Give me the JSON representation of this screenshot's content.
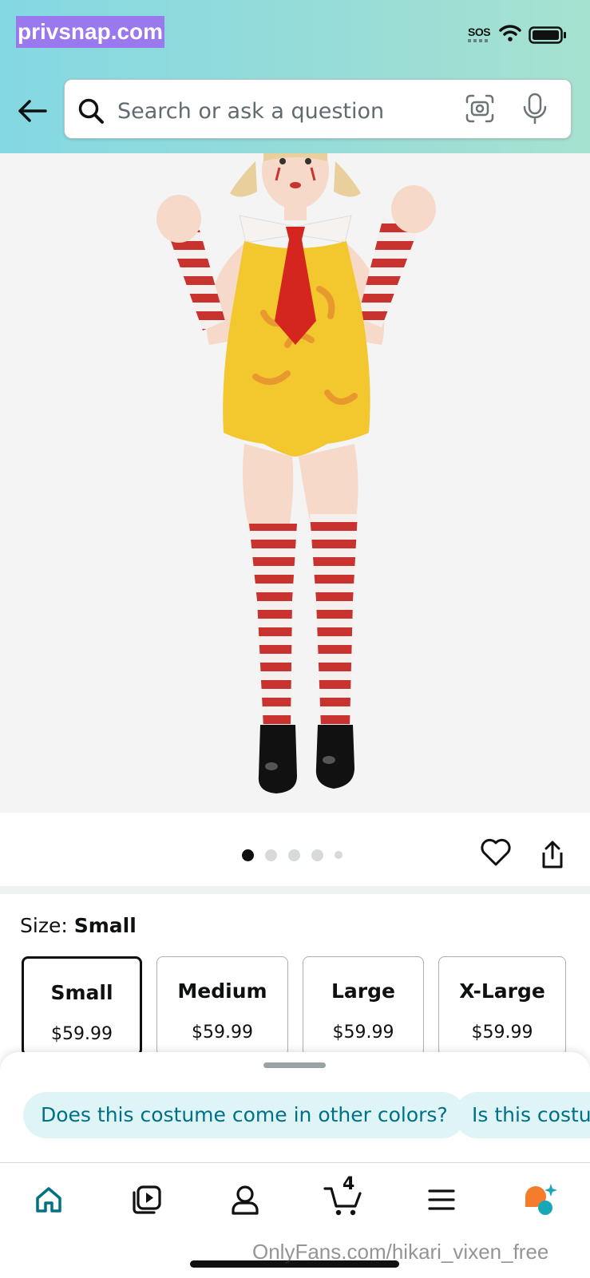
{
  "watermark_top": "privsnap.com",
  "status_bar": {
    "sos": "SOS"
  },
  "search": {
    "placeholder": "Search or ask a question"
  },
  "product": {
    "image_count": 5,
    "active_image": 1
  },
  "size": {
    "label": "Size: ",
    "selected": "Small",
    "options": [
      {
        "name": "Small",
        "price": "$59.99"
      },
      {
        "name": "Medium",
        "price": "$59.99"
      },
      {
        "name": "Large",
        "price": "$59.99"
      },
      {
        "name": "X-Large",
        "price": "$59.99"
      }
    ]
  },
  "suggestions": [
    "Does this costume come in other colors?",
    "Is this costur"
  ],
  "nav": {
    "cart_count": "4"
  },
  "colors": {
    "accent": "#007185",
    "chip_bg": "#dff4f7",
    "header_start": "#84d8e3",
    "header_end": "#a6e2d0"
  },
  "watermark_bottom": "OnlyFans.com/hikari_vixen_free"
}
